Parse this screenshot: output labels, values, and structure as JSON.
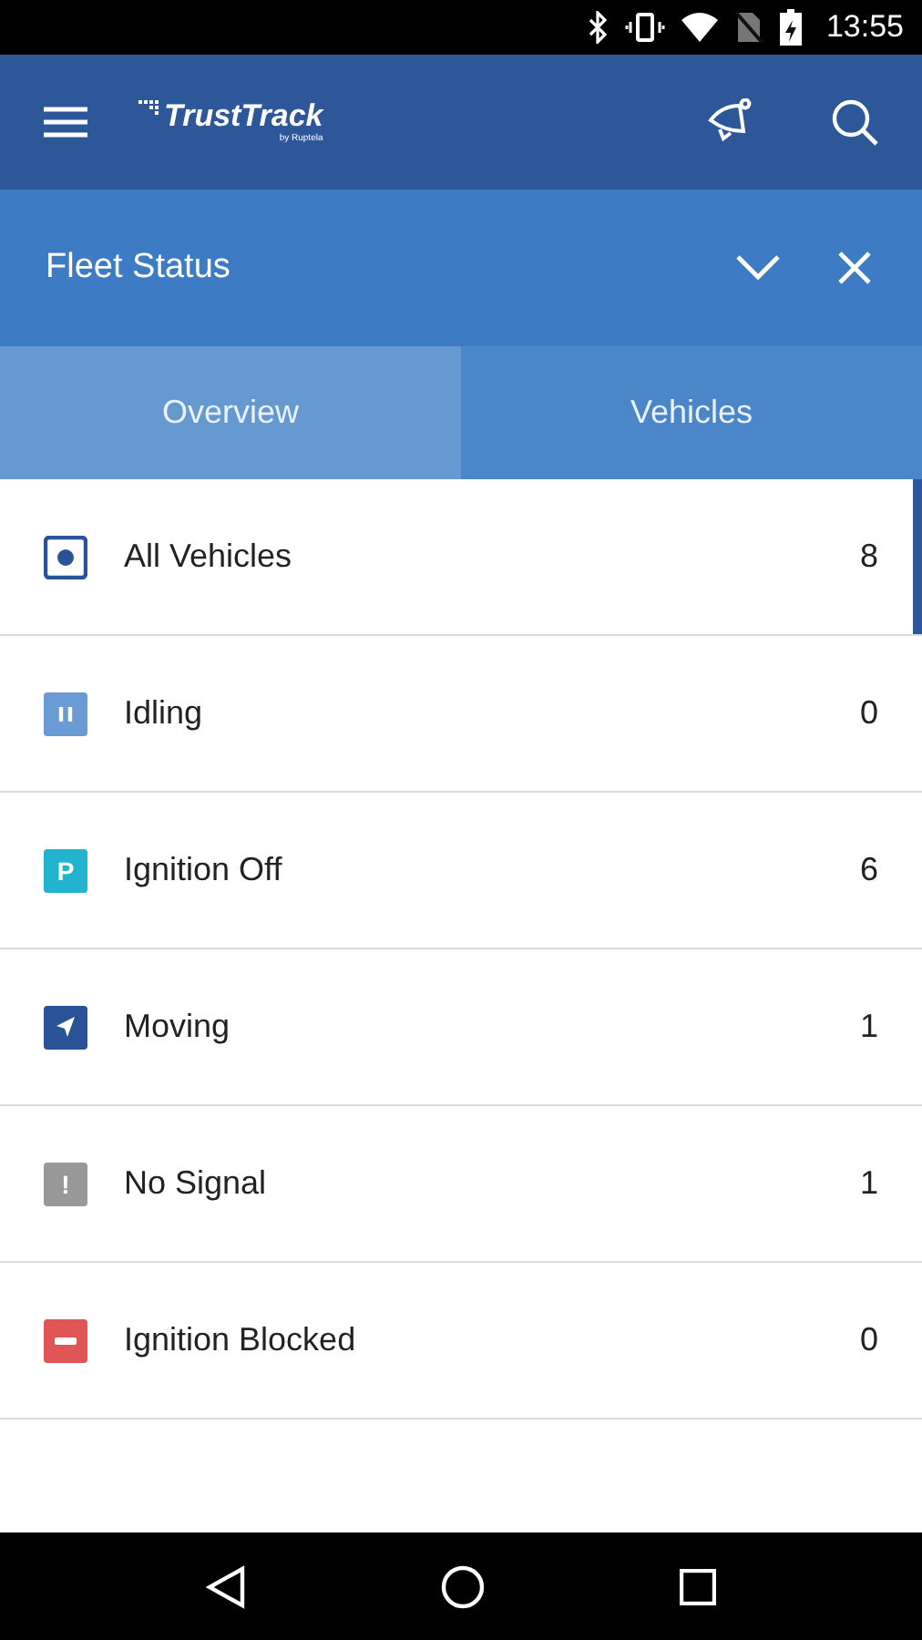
{
  "status_bar": {
    "time": "13:55"
  },
  "app_bar": {
    "logo": "TrustTrack",
    "logo_sub": "by Ruptela"
  },
  "panel": {
    "title": "Fleet Status"
  },
  "tabs": [
    {
      "label": "Overview",
      "selected": true
    },
    {
      "label": "Vehicles",
      "selected": false
    }
  ],
  "rows": [
    {
      "kind": "all",
      "label": "All Vehicles",
      "count": "8",
      "color": "#2a5298",
      "selected": true
    },
    {
      "kind": "idling",
      "label": "Idling",
      "count": "0",
      "color": "#6a9bd4",
      "selected": false
    },
    {
      "kind": "parked",
      "glyph": "P",
      "label": "Ignition Off",
      "count": "6",
      "color": "#22b3cf",
      "selected": false
    },
    {
      "kind": "moving",
      "label": "Moving",
      "count": "1",
      "color": "#2a5298",
      "selected": false
    },
    {
      "kind": "nosignal",
      "glyph": "!",
      "label": "No Signal",
      "count": "1",
      "color": "#999999",
      "selected": false
    },
    {
      "kind": "blocked",
      "label": "Ignition Blocked",
      "count": "0",
      "color": "#e05555",
      "selected": false
    }
  ]
}
